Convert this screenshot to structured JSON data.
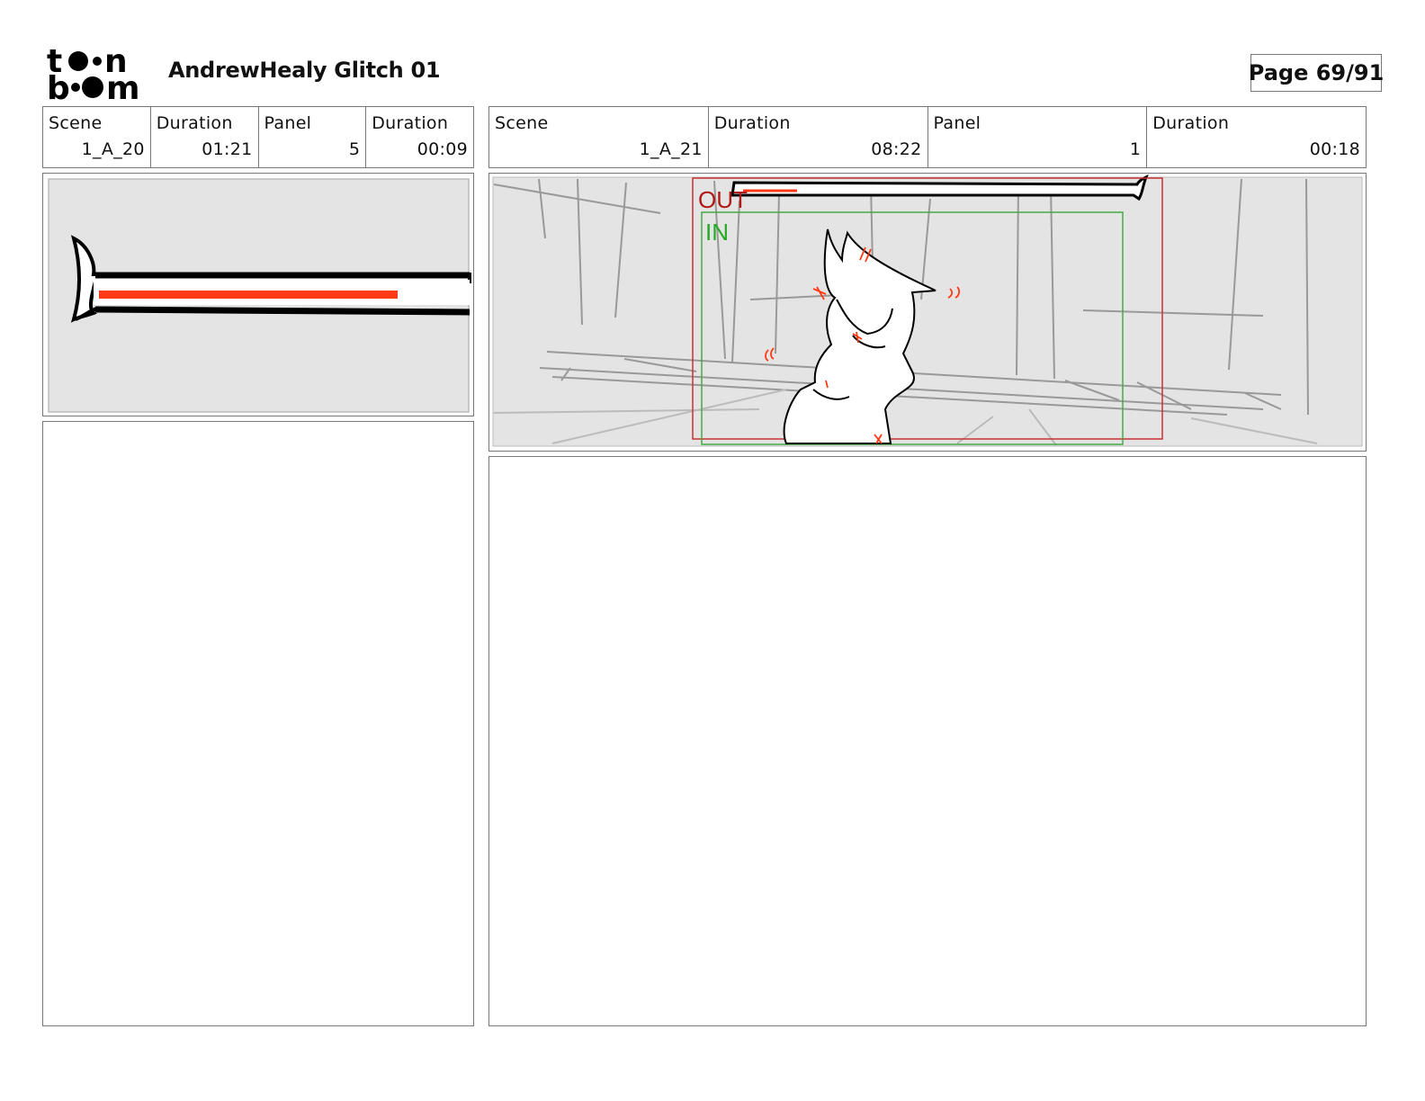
{
  "header": {
    "logo_text": "toon boom",
    "title": "AndrewHealy Glitch 01",
    "page": "Page 69/91"
  },
  "left_panel": {
    "scene_label": "Scene",
    "scene_value": "1_A_20",
    "scene_duration_label": "Duration",
    "scene_duration_value": "01:21",
    "panel_label": "Panel",
    "panel_value": "5",
    "panel_duration_label": "Duration",
    "panel_duration_value": "00:09"
  },
  "right_panel": {
    "scene_label": "Scene",
    "scene_value": "1_A_21",
    "scene_duration_label": "Duration",
    "scene_duration_value": "08:22",
    "panel_label": "Panel",
    "panel_value": "1",
    "panel_duration_label": "Duration",
    "panel_duration_value": "00:18",
    "out_label": "OUT",
    "in_label": "IN"
  },
  "colors": {
    "sketch_bg": "#e4e4e4",
    "accent_red": "#ff3a14",
    "out_frame": "#b01818",
    "in_frame": "#22aa22"
  }
}
